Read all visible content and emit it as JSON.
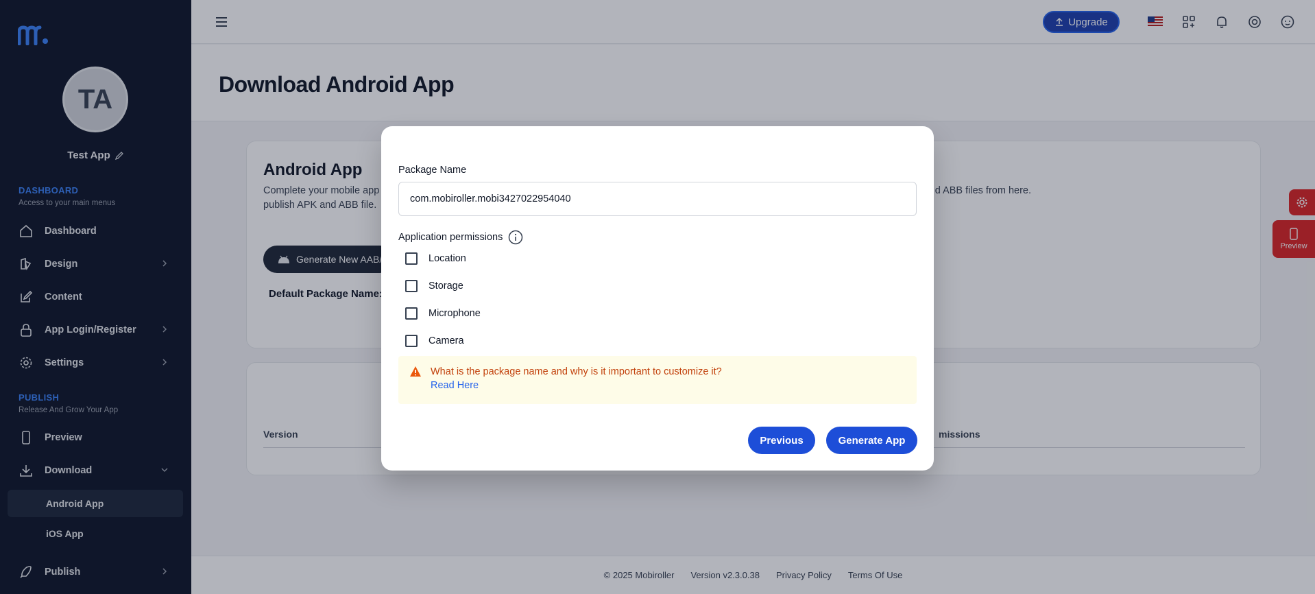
{
  "sidebar": {
    "avatar_initials": "TA",
    "app_name": "Test App",
    "sections": {
      "dashboard_title": "DASHBOARD",
      "dashboard_sub": "Access to your main menus",
      "publish_title": "PUBLISH",
      "publish_sub": "Release And Grow Your App"
    },
    "items": {
      "dashboard": "Dashboard",
      "design": "Design",
      "content": "Content",
      "app_login": "App Login/Register",
      "settings": "Settings",
      "preview": "Preview",
      "download": "Download",
      "android_app": "Android App",
      "ios_app": "iOS App",
      "publish": "Publish"
    }
  },
  "header": {
    "upgrade_label": "Upgrade"
  },
  "page": {
    "title": "Download Android App"
  },
  "card": {
    "title": "Android App",
    "desc_line1_left": "Complete your mobile app d",
    "desc_line1_right": "d ABB files from here.",
    "desc_line2": "publish APK and ABB file.",
    "generate_label": "Generate New AAB/",
    "default_package": "Default Package Name:"
  },
  "table": {
    "col_version": "Version",
    "col_permissions": "missions"
  },
  "float": {
    "preview_label": "Preview"
  },
  "modal": {
    "package_label": "Package Name",
    "package_value": "com.mobiroller.mobi3427022954040",
    "permissions_label": "Application permissions",
    "permissions": [
      "Location",
      "Storage",
      "Microphone",
      "Camera"
    ],
    "warning_text": "What is the package name and why is it important to customize it?",
    "warning_link": "Read Here",
    "previous_label": "Previous",
    "generate_label": "Generate App"
  },
  "footer": {
    "copyright": "© 2025 Mobiroller",
    "version": "Version v2.3.0.38",
    "privacy": "Privacy Policy",
    "terms": "Terms Of Use"
  },
  "colors": {
    "sidebar_bg": "#0f172a",
    "accent_blue": "#1d4ed8",
    "danger_red": "#dc2626",
    "warning_bg": "#fefce8",
    "warning_text": "#c2410c"
  }
}
